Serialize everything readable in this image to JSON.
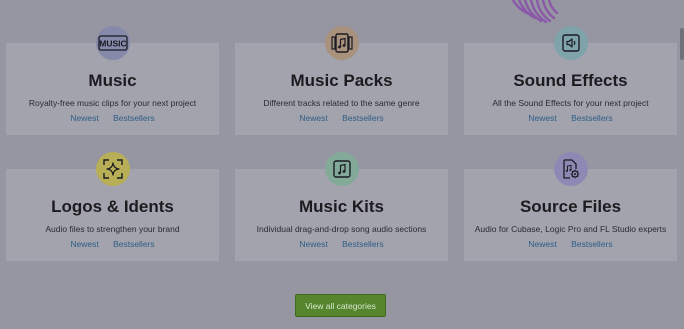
{
  "categories": [
    {
      "title": "Music",
      "description": "Royalty-free music clips for your next project",
      "links": [
        "Newest",
        "Bestsellers"
      ],
      "icon": "music-text-icon",
      "icon_text": "MUSIC",
      "icon_bg": "#8589aa"
    },
    {
      "title": "Music Packs",
      "description": "Different tracks related to the same genre",
      "links": [
        "Newest",
        "Bestsellers"
      ],
      "icon": "music-pack-icon",
      "icon_bg": "#a8917d"
    },
    {
      "title": "Sound Effects",
      "description": "All the Sound Effects for your next project",
      "links": [
        "Newest",
        "Bestsellers"
      ],
      "icon": "speaker-icon",
      "icon_bg": "#7fa3ab"
    },
    {
      "title": "Logos & Idents",
      "description": "Audio files to strengthen your brand",
      "links": [
        "Newest",
        "Bestsellers"
      ],
      "icon": "sparkle-frame-icon",
      "icon_bg": "#b7ae55"
    },
    {
      "title": "Music Kits",
      "description": "Individual drag-and-drop song audio sections",
      "links": [
        "Newest",
        "Bestsellers"
      ],
      "icon": "music-note-icon",
      "icon_bg": "#83aa99"
    },
    {
      "title": "Source Files",
      "description": "Audio for Cubase, Logic Pro and FL Studio experts",
      "links": [
        "Newest",
        "Bestsellers"
      ],
      "icon": "file-gear-icon",
      "icon_bg": "#8e88b4"
    }
  ],
  "view_all_label": "View all categories",
  "colors": {
    "overlay_bg": "#9596a2",
    "card_bg": "#a3a3ad",
    "link": "#2d5e86",
    "button_bg": "#55862d"
  }
}
